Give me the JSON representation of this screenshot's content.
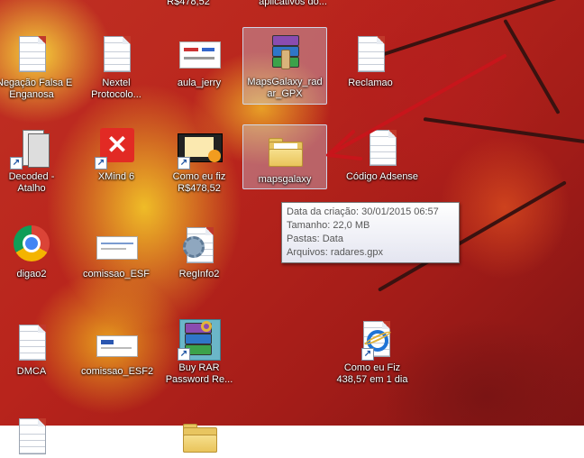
{
  "top_fragments": {
    "left": "R$478,52",
    "right": "aplicativos do..."
  },
  "icons": [
    {
      "key": "negacao",
      "label": "Negação Falsa E\nEnganosa"
    },
    {
      "key": "nextel",
      "label": "Nextel\nProtocolo..."
    },
    {
      "key": "aula",
      "label": "aula_jerry"
    },
    {
      "key": "mapsgalaxy_rar",
      "label": "MapsGalaxy_rad\nar_GPX"
    },
    {
      "key": "reclamao",
      "label": "Reclamao"
    },
    {
      "key": "decoded",
      "label": "Decoded -\nAtalho"
    },
    {
      "key": "xmind",
      "label": "XMind 6"
    },
    {
      "key": "comoeufiz",
      "label": "Como eu fiz\nR$478,52"
    },
    {
      "key": "mapsgalaxy",
      "label": "mapsgalaxy"
    },
    {
      "key": "codigo",
      "label": "Código Adsense"
    },
    {
      "key": "digao",
      "label": "digao2"
    },
    {
      "key": "comissao",
      "label": "comissao_ESF"
    },
    {
      "key": "reginfo",
      "label": "RegInfo2"
    },
    {
      "key": "dmca",
      "label": "DMCA"
    },
    {
      "key": "comissao2",
      "label": "comissao_ESF2"
    },
    {
      "key": "buyrar",
      "label": "Buy RAR\nPassword Re..."
    },
    {
      "key": "comoeufiz2",
      "label": "Como eu Fiz\n438,57 em 1 dia"
    }
  ],
  "tooltip": {
    "created": "Data da criação: 30/01/2015 06:57",
    "size": "Tamanho: 22,0 MB",
    "folders": "Pastas: Data",
    "files": "Arquivos: radares.gpx"
  },
  "colors": {
    "accent_arrow": "#c8151b",
    "folder": "#e8c560",
    "selection": "#c8dcf5"
  }
}
